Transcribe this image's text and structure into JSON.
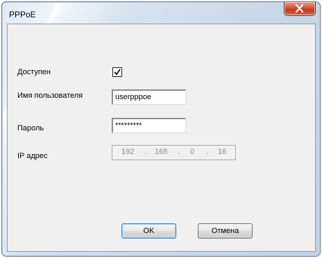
{
  "window": {
    "title": "PPPoE"
  },
  "form": {
    "enabled_label": "Доступен",
    "enabled_checked": true,
    "username_label": "Имя пользователя",
    "username_value": "userpppoe",
    "password_label": "Пароль",
    "password_value": "*********",
    "ip_label": "IP адрес",
    "ip_octets": [
      "192",
      "168",
      "0",
      "16"
    ],
    "ip_dot": "."
  },
  "buttons": {
    "ok_label": "OK",
    "cancel_label": "Отмена"
  },
  "icons": {
    "close": "close-icon",
    "check": "check-icon"
  },
  "colors": {
    "close_button": "#c1361f",
    "client_bg": "#f0f0f0"
  }
}
